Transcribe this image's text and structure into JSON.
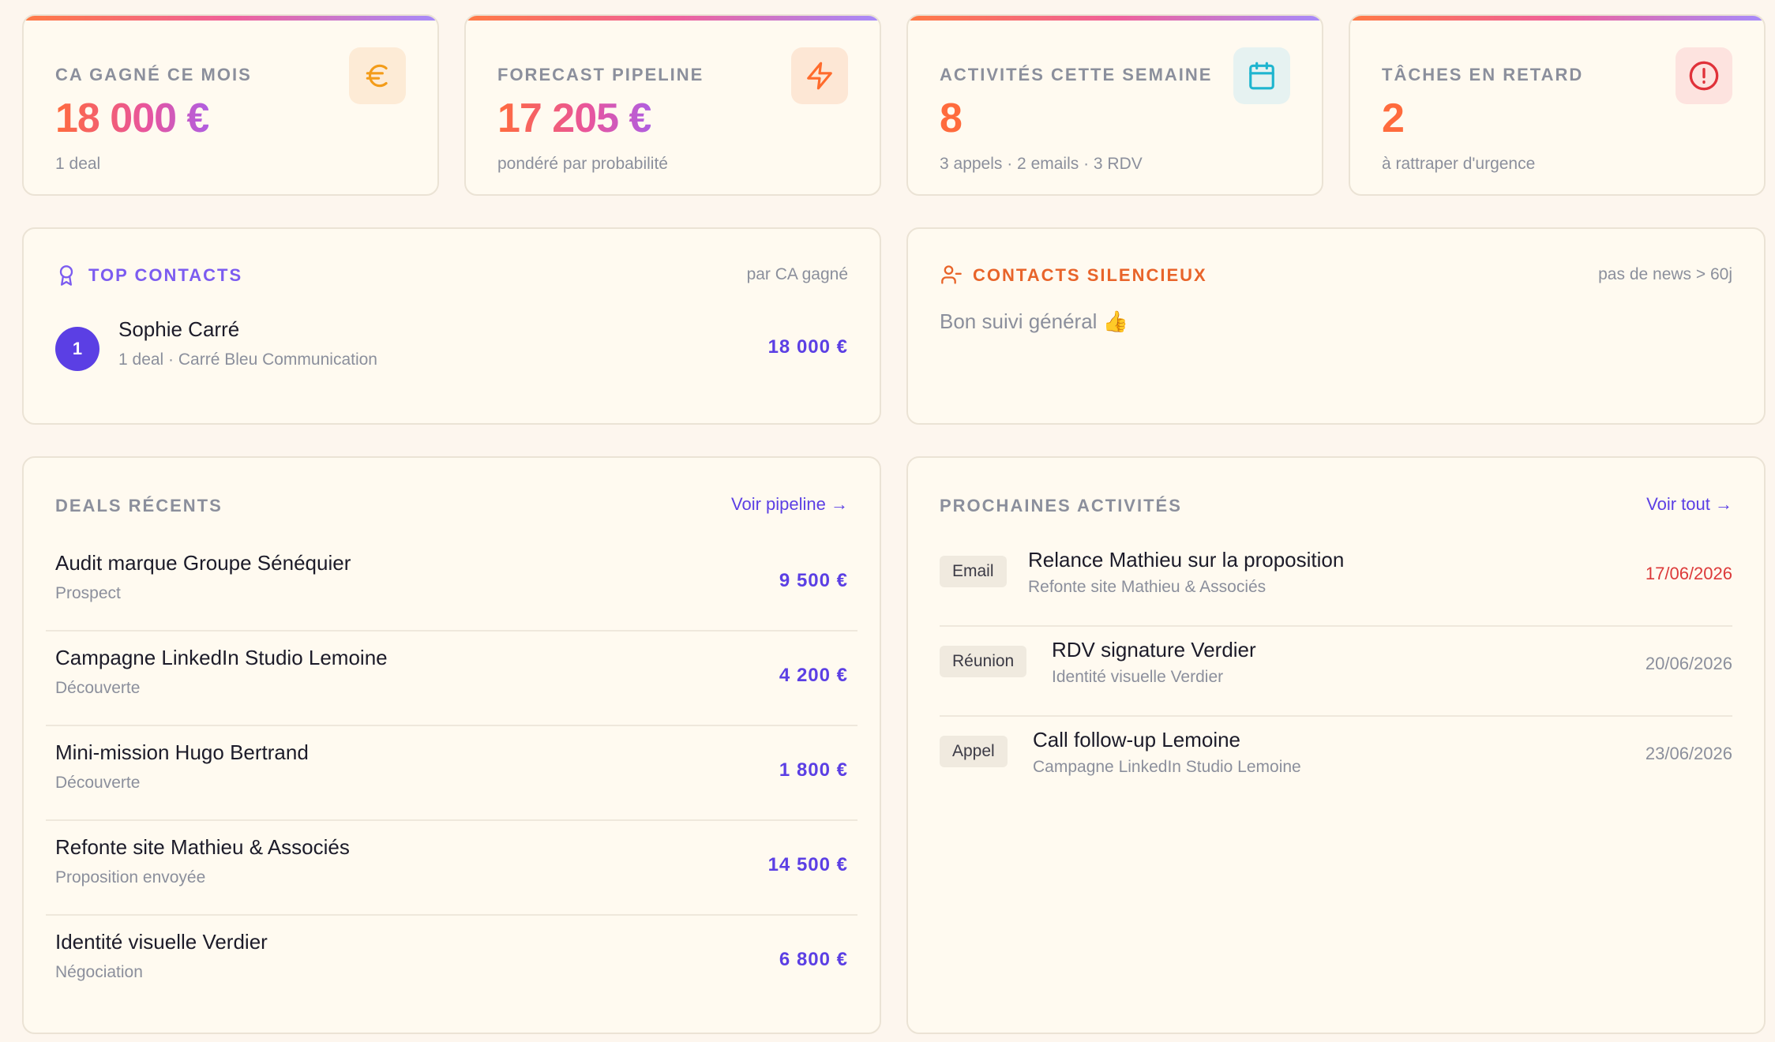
{
  "kpis": [
    {
      "label": "CA GAGNÉ CE MOIS",
      "value": "18 000 €",
      "sub": "1 deal",
      "icon": "euro-icon",
      "icon_bg": "#fdebd6",
      "icon_color": "#f39c1a"
    },
    {
      "label": "FORECAST PIPELINE",
      "value": "17 205 €",
      "sub": "pondéré par probabilité",
      "icon": "lightning-icon",
      "icon_bg": "#fde7d5",
      "icon_color": "#ff6b2c"
    },
    {
      "label": "ACTIVITÉS CETTE SEMAINE",
      "value": "8",
      "sub": "3 appels · 2 emails · 3 RDV",
      "icon": "calendar-icon",
      "icon_bg": "#e6f2f1",
      "icon_color": "#1fb5cf"
    },
    {
      "label": "TÂCHES EN RETARD",
      "value": "2",
      "sub": "à rattraper d'urgence",
      "icon": "alert-icon",
      "icon_bg": "#fde3df",
      "icon_color": "#e0323a"
    }
  ],
  "top_contacts": {
    "title": "TOP CONTACTS",
    "meta": "par CA gagné",
    "items": [
      {
        "rank": "1",
        "name": "Sophie Carré",
        "detail": "1 deal · Carré Bleu Communication",
        "amount": "18 000 €"
      }
    ]
  },
  "silent_contacts": {
    "title": "CONTACTS SILENCIEUX",
    "meta": "pas de news > 60j",
    "message": "Bon suivi général 👍"
  },
  "recent_deals": {
    "title": "DEALS RÉCENTS",
    "link": "Voir pipeline →",
    "items": [
      {
        "name": "Audit marque Groupe Sénéquier",
        "stage": "Prospect",
        "amount": "9 500 €"
      },
      {
        "name": "Campagne LinkedIn Studio Lemoine",
        "stage": "Découverte",
        "amount": "4 200 €"
      },
      {
        "name": "Mini-mission Hugo Bertrand",
        "stage": "Découverte",
        "amount": "1 800 €"
      },
      {
        "name": "Refonte site Mathieu & Associés",
        "stage": "Proposition envoyée",
        "amount": "14 500 €"
      },
      {
        "name": "Identité visuelle Verdier",
        "stage": "Négociation",
        "amount": "6 800 €"
      }
    ]
  },
  "next_activities": {
    "title": "PROCHAINES ACTIVITÉS",
    "link": "Voir tout →",
    "items": [
      {
        "type": "Email",
        "title": "Relance Mathieu sur la proposition",
        "sub": "Refonte site Mathieu & Associés",
        "date": "17/06/2026",
        "overdue": true
      },
      {
        "type": "Réunion",
        "title": "RDV signature Verdier",
        "sub": "Identité visuelle Verdier",
        "date": "20/06/2026",
        "overdue": false
      },
      {
        "type": "Appel",
        "title": "Call follow-up Lemoine",
        "sub": "Campagne LinkedIn Studio Lemoine",
        "date": "23/06/2026",
        "overdue": false
      }
    ]
  },
  "colors": {
    "accent": "#5b3fe4",
    "overdue": "#dc3a3a",
    "muted": "#8b8f9c",
    "top_contacts_title": "#7c5cf0",
    "silent_title": "#e8642a"
  }
}
